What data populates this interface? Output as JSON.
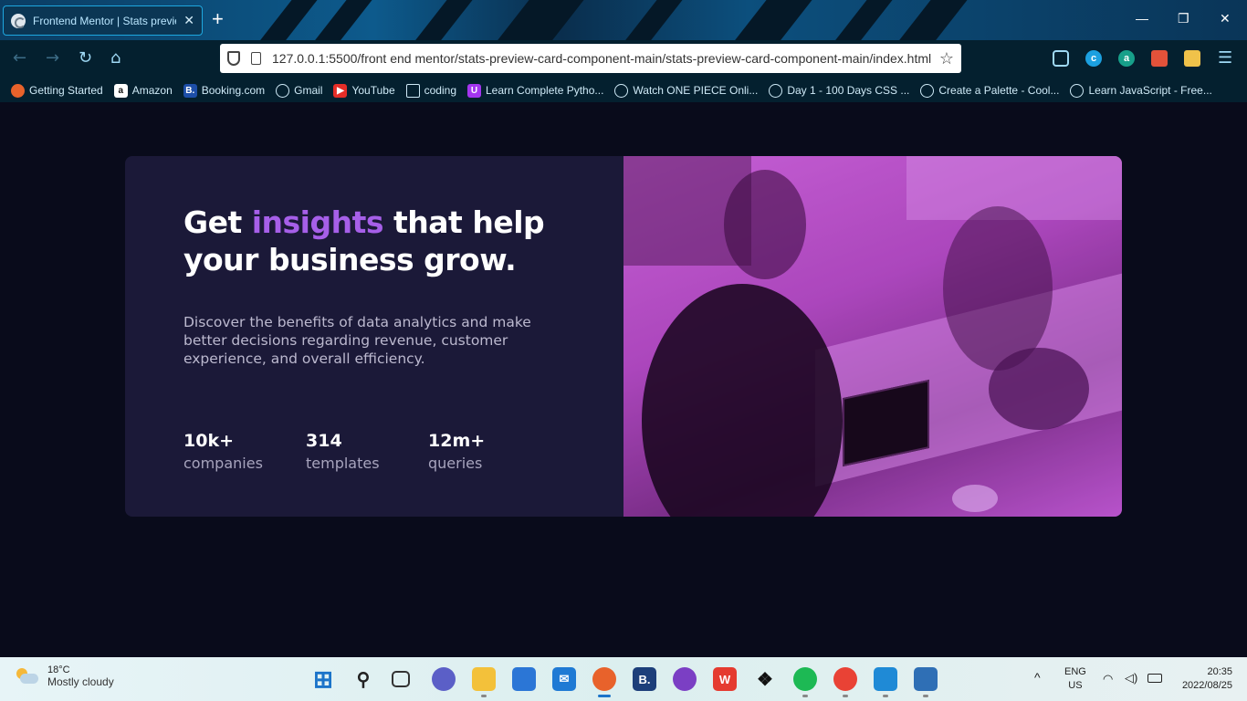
{
  "browser": {
    "tab_title": "Frontend Mentor | Stats preview card component",
    "tab_close": "✕",
    "new_tab": "+",
    "minimize": "—",
    "restore": "❐",
    "close": "✕",
    "url": "127.0.0.1:5500/front end mentor/stats-preview-card-component-main/stats-preview-card-component-main/index.html",
    "extensions": [
      {
        "name": "pocket-icon",
        "letter": "",
        "color": "#04202f"
      },
      {
        "name": "c-extension-icon",
        "letter": "c",
        "color": "#1ca0e0"
      },
      {
        "name": "a-extension-icon",
        "letter": "a",
        "color": "#17a08a"
      },
      {
        "name": "camera-extension-icon",
        "letter": "",
        "color": "#e3523a"
      },
      {
        "name": "notes-extension-icon",
        "letter": "",
        "color": "#f0c24a"
      }
    ],
    "menu": "☰"
  },
  "bookmarks": [
    {
      "label": "Getting Started",
      "icon": "firefox-icon",
      "color": "#e8622b",
      "letter": ""
    },
    {
      "label": "Amazon",
      "icon": "amazon-icon",
      "color": "#ffffff",
      "letter": "a"
    },
    {
      "label": "Booking.com",
      "icon": "booking-icon",
      "color": "#1d4ea8",
      "letter": "B."
    },
    {
      "label": "Gmail",
      "icon": "globe-icon",
      "color": "",
      "letter": ""
    },
    {
      "label": "YouTube",
      "icon": "youtube-icon",
      "color": "#e52d27",
      "letter": "▶"
    },
    {
      "label": "coding",
      "icon": "folder-icon",
      "color": "",
      "letter": ""
    },
    {
      "label": "Learn Complete Pytho...",
      "icon": "udemy-icon",
      "color": "#a435f0",
      "letter": "U"
    },
    {
      "label": "Watch ONE PIECE Onli...",
      "icon": "globe-icon",
      "color": "",
      "letter": ""
    },
    {
      "label": "Day 1 - 100 Days CSS ...",
      "icon": "globe-icon",
      "color": "",
      "letter": ""
    },
    {
      "label": "Create a Palette - Cool...",
      "icon": "globe-icon",
      "color": "",
      "letter": ""
    },
    {
      "label": "Learn JavaScript - Free...",
      "icon": "globe-icon",
      "color": "",
      "letter": ""
    }
  ],
  "card": {
    "headline_pre": "Get ",
    "headline_accent": "insights",
    "headline_post": " that help your business grow.",
    "description": "Discover the benefits of data analytics and make better decisions regarding revenue, customer experience, and overall efficiency.",
    "stats": [
      {
        "value": "10k+",
        "label": "companies"
      },
      {
        "value": "314",
        "label": "templates"
      },
      {
        "value": "12m+",
        "label": "queries"
      }
    ],
    "colors": {
      "card_bg": "#1b1938",
      "accent": "#a65fe8",
      "page_bg": "#090b1b"
    }
  },
  "taskbar": {
    "temperature": "18°C",
    "condition": "Mostly cloudy",
    "apps": [
      {
        "name": "start-icon",
        "letter": "⊞",
        "color": "#1a73c9"
      },
      {
        "name": "search-icon",
        "letter": "⚲",
        "color": "#222"
      },
      {
        "name": "task-view-icon",
        "letter": "",
        "color": "#333"
      },
      {
        "name": "chat-icon",
        "letter": "",
        "color": "#5b5fc7"
      },
      {
        "name": "file-explorer-icon",
        "letter": "",
        "color": "#f3c13a"
      },
      {
        "name": "store-icon",
        "letter": "",
        "color": "#2b76d6"
      },
      {
        "name": "mail-icon",
        "letter": "✉",
        "color": "#1f7ad4"
      },
      {
        "name": "firefox-icon",
        "letter": "",
        "color": "#e8622b"
      },
      {
        "name": "booking-icon",
        "letter": "B.",
        "color": "#1d3f7a"
      },
      {
        "name": "github-icon",
        "letter": "",
        "color": "#7b3fc4"
      },
      {
        "name": "wps-icon",
        "letter": "W",
        "color": "#e53b30"
      },
      {
        "name": "dropbox-icon",
        "letter": "❖",
        "color": "#111"
      },
      {
        "name": "spotify-icon",
        "letter": "",
        "color": "#1db954"
      },
      {
        "name": "chrome-icon",
        "letter": "",
        "color": "#e94235"
      },
      {
        "name": "vscode-icon",
        "letter": "",
        "color": "#1f8ad6"
      },
      {
        "name": "photos-icon",
        "letter": "",
        "color": "#2f6fb5"
      }
    ],
    "lang_top": "ENG",
    "lang_bottom": "US",
    "time": "20:35",
    "date": "2022/08/25",
    "chevron": "^"
  }
}
